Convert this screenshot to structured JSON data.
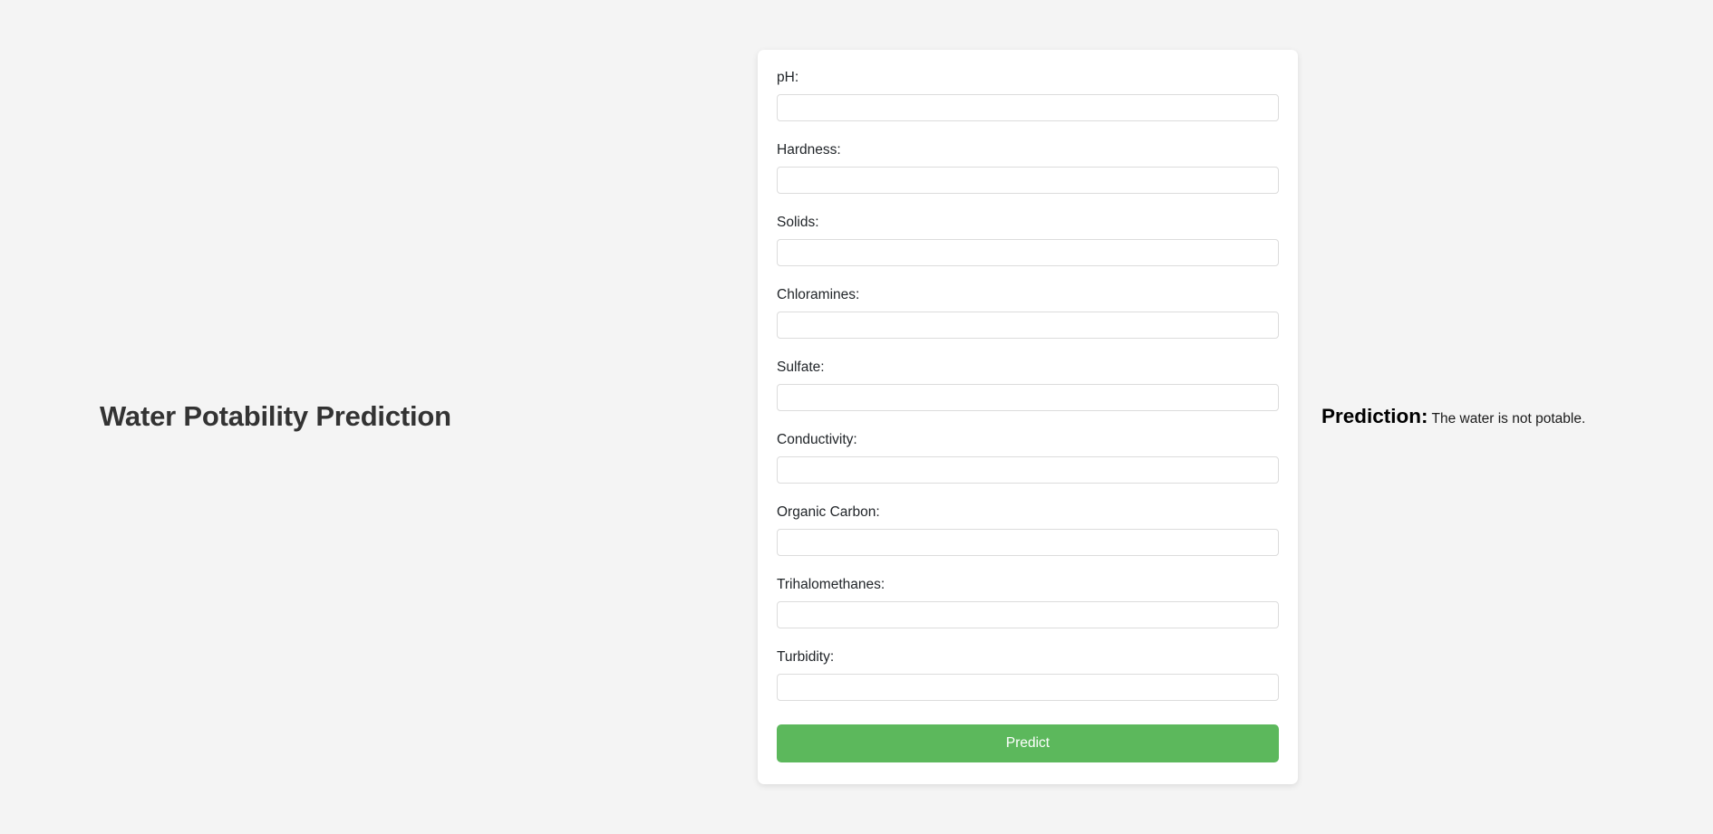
{
  "page": {
    "title": "Water Potability Prediction",
    "background_color": "#f4f4f4"
  },
  "form": {
    "fields": [
      {
        "label": "pH:",
        "value": "",
        "placeholder": ""
      },
      {
        "label": "Hardness:",
        "value": "",
        "placeholder": ""
      },
      {
        "label": "Solids:",
        "value": "",
        "placeholder": ""
      },
      {
        "label": "Chloramines:",
        "value": "",
        "placeholder": ""
      },
      {
        "label": "Sulfate:",
        "value": "",
        "placeholder": ""
      },
      {
        "label": "Conductivity:",
        "value": "",
        "placeholder": ""
      },
      {
        "label": "Organic Carbon:",
        "value": "",
        "placeholder": ""
      },
      {
        "label": "Trihalomethanes:",
        "value": "",
        "placeholder": ""
      },
      {
        "label": "Turbidity:",
        "value": "",
        "placeholder": ""
      }
    ],
    "submit": {
      "label": "Predict",
      "color": "#5cb85c"
    }
  },
  "result": {
    "heading": "Prediction:",
    "text": "The water is not potable."
  }
}
